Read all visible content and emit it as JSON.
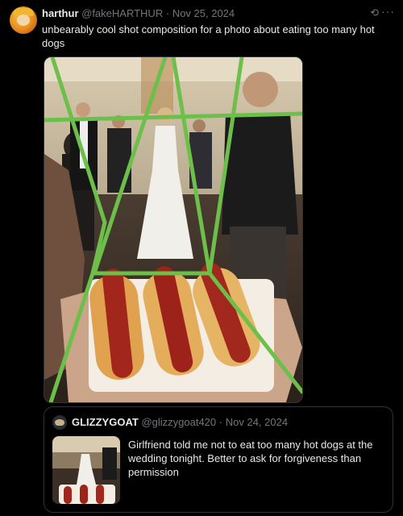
{
  "tweet": {
    "display_name": "harthur",
    "handle": "@fakeHARTHUR",
    "separator": "·",
    "date": "Nov 25, 2024",
    "text": "unbearably cool shot composition for a photo about eating too many hot dogs",
    "more_glyph": "···",
    "grok_glyph": "⟲"
  },
  "quoted": {
    "display_name": "GLIZZYGOAT",
    "handle": "@glizzygoat420",
    "separator": "·",
    "date": "Nov 24, 2024",
    "text": "Girlfriend told me not to eat too many hot dogs at the wedding tonight. Better to ask for forgiveness than permission"
  },
  "colors": {
    "background": "#000000",
    "text_primary": "#e7e9ea",
    "text_secondary": "#71767b",
    "border": "#2f3336",
    "annotation_green": "#6cc04a"
  },
  "icons": [
    "avatar",
    "grok-icon",
    "more-icon"
  ]
}
